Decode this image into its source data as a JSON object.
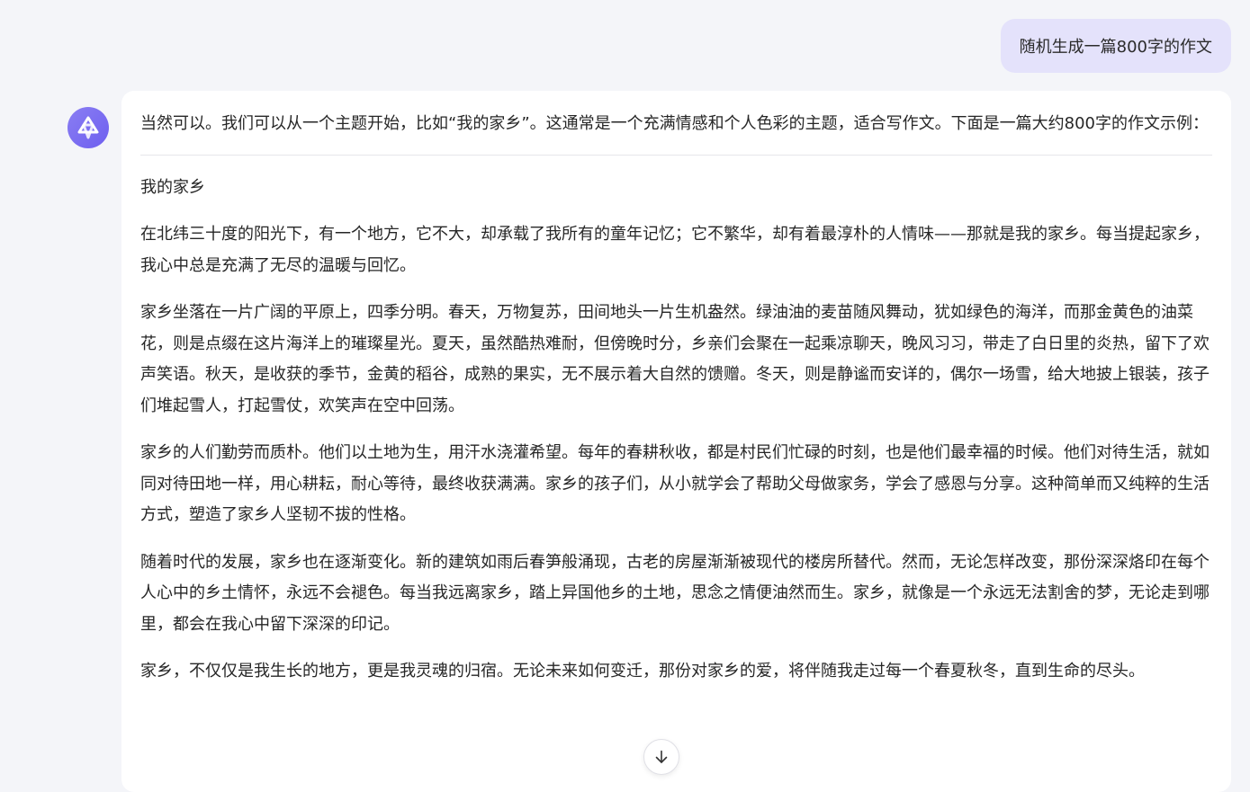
{
  "user_message": {
    "text": "随机生成一篇800字的作文"
  },
  "assistant": {
    "avatar_icon": "kimi-logo-icon",
    "intro": "当然可以。我们可以从一个主题开始，比如“我的家乡”。这通常是一个充满情感和个人色彩的主题，适合写作文。下面是一篇大约800字的作文示例：",
    "essay_title": "我的家乡",
    "paragraphs": [
      "在北纬三十度的阳光下，有一个地方，它不大，却承载了我所有的童年记忆；它不繁华，却有着最淳朴的人情味——那就是我的家乡。每当提起家乡，我心中总是充满了无尽的温暖与回忆。",
      "家乡坐落在一片广阔的平原上，四季分明。春天，万物复苏，田间地头一片生机盎然。绿油油的麦苗随风舞动，犹如绿色的海洋，而那金黄色的油菜花，则是点缀在这片海洋上的璀璨星光。夏天，虽然酷热难耐，但傍晚时分，乡亲们会聚在一起乘凉聊天，晚风习习，带走了白日里的炎热，留下了欢声笑语。秋天，是收获的季节，金黄的稻谷，成熟的果实，无不展示着大自然的馈赠。冬天，则是静谧而安详的，偶尔一场雪，给大地披上银装，孩子们堆起雪人，打起雪仗，欢笑声在空中回荡。",
      "家乡的人们勤劳而质朴。他们以土地为生，用汗水浇灌希望。每年的春耕秋收，都是村民们忙碌的时刻，也是他们最幸福的时候。他们对待生活，就如同对待田地一样，用心耕耘，耐心等待，最终收获满满。家乡的孩子们，从小就学会了帮助父母做家务，学会了感恩与分享。这种简单而又纯粹的生活方式，塑造了家乡人坚韧不拔的性格。",
      "随着时代的发展，家乡也在逐渐变化。新的建筑如雨后春笋般涌现，古老的房屋渐渐被现代的楼房所替代。然而，无论怎样改变，那份深深烙印在每个人心中的乡土情怀，永远不会褪色。每当我远离家乡，踏上异国他乡的土地，思念之情便油然而生。家乡，就像是一个永远无法割舍的梦，无论走到哪里，都会在我心中留下深深的印记。",
      "家乡，不仅仅是我生长的地方，更是我灵魂的归宿。无论未来如何变迁，那份对家乡的爱，将伴随我走过每一个春夏秋冬，直到生命的尽头。"
    ]
  },
  "scroll_button_icon": "arrow-down-icon"
}
